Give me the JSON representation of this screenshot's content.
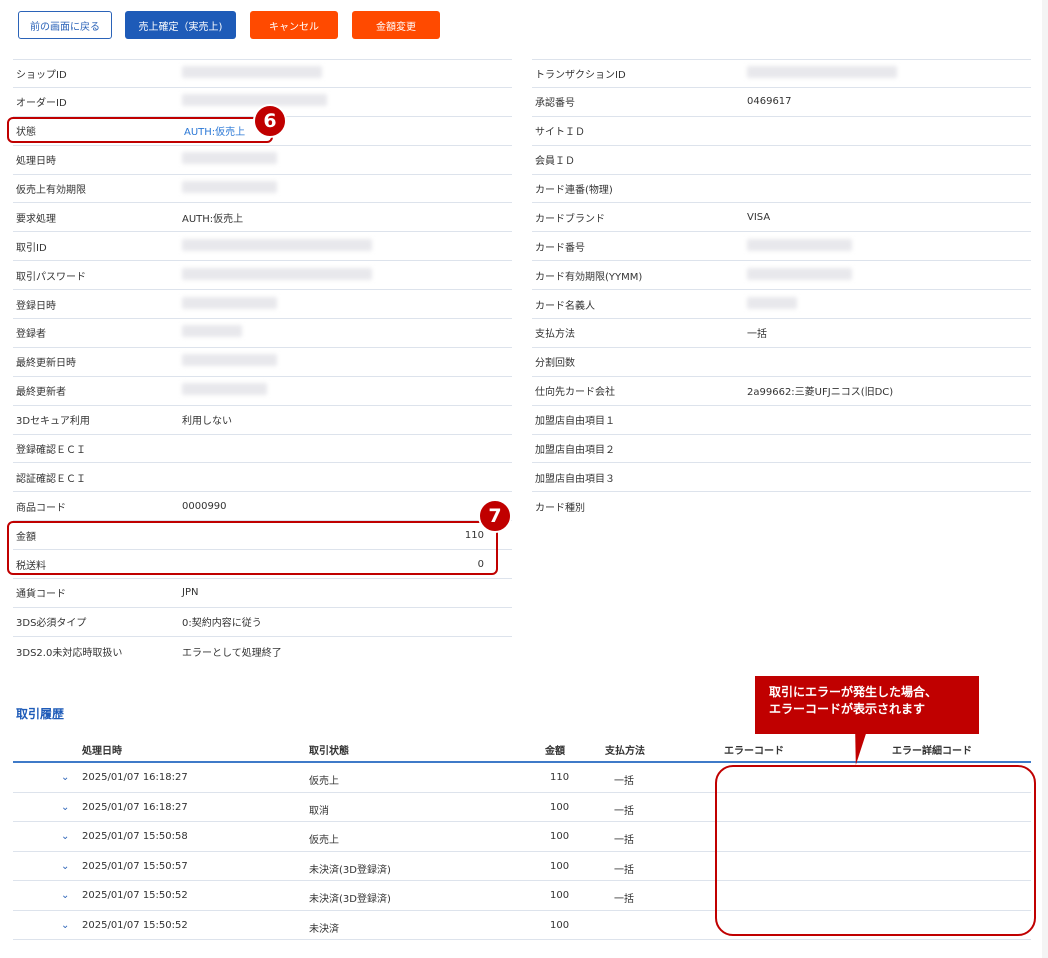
{
  "buttons": {
    "back": "前の画面に戻る",
    "confirm": "売上確定（実売上)",
    "cancel": "キャンセル",
    "amount_change": "金額変更"
  },
  "detail_left": [
    {
      "label": "ショップID",
      "value": ""
    },
    {
      "label": "オーダーID",
      "value": ""
    },
    {
      "label": "状態",
      "value": "AUTH:仮売上"
    },
    {
      "label": "処理日時",
      "value": ""
    },
    {
      "label": "仮売上有効期限",
      "value": ""
    },
    {
      "label": "要求処理",
      "value": "AUTH:仮売上"
    },
    {
      "label": "取引ID",
      "value": ""
    },
    {
      "label": "取引パスワード",
      "value": ""
    },
    {
      "label": "登録日時",
      "value": ""
    },
    {
      "label": "登録者",
      "value": ""
    },
    {
      "label": "最終更新日時",
      "value": ""
    },
    {
      "label": "最終更新者",
      "value": ""
    },
    {
      "label": "3Dセキュア利用",
      "value": "利用しない"
    },
    {
      "label": "登録確認ＥＣＩ",
      "value": ""
    },
    {
      "label": "認証確認ＥＣＩ",
      "value": ""
    },
    {
      "label": "商品コード",
      "value": "0000990"
    },
    {
      "label": "金額",
      "value": "110"
    },
    {
      "label": "税送料",
      "value": "0"
    },
    {
      "label": "通貨コード",
      "value": "JPN"
    },
    {
      "label": "3DS必須タイプ",
      "value": "0:契約内容に従う"
    },
    {
      "label": "3DS2.0未対応時取扱い",
      "value": "エラーとして処理終了"
    }
  ],
  "detail_right": [
    {
      "label": "トランザクションID",
      "value": ""
    },
    {
      "label": "承認番号",
      "value": "0469617"
    },
    {
      "label": "サイトＩＤ",
      "value": ""
    },
    {
      "label": "会員ＩＤ",
      "value": ""
    },
    {
      "label": "カード連番(物理)",
      "value": ""
    },
    {
      "label": "カードブランド",
      "value": "VISA"
    },
    {
      "label": "カード番号",
      "value": ""
    },
    {
      "label": "カード有効期限(YYMM)",
      "value": ""
    },
    {
      "label": "カード名義人",
      "value": ""
    },
    {
      "label": "支払方法",
      "value": "一括"
    },
    {
      "label": "分割回数",
      "value": ""
    },
    {
      "label": "仕向先カード会社",
      "value": "2a99662:三菱UFJニコス(旧DC)"
    },
    {
      "label": "加盟店自由項目１",
      "value": ""
    },
    {
      "label": "加盟店自由項目２",
      "value": ""
    },
    {
      "label": "加盟店自由項目３",
      "value": ""
    },
    {
      "label": "カード種別",
      "value": ""
    }
  ],
  "badges": {
    "status": "6",
    "amount": "7"
  },
  "history": {
    "title": "取引履歴",
    "columns": [
      "処理日時",
      "取引状態",
      "金額",
      "支払方法",
      "エラーコード",
      "エラー詳細コード"
    ],
    "rows": [
      {
        "date": "2025/01/07 16:18:27",
        "status": "仮売上",
        "amount": "110",
        "method": "一括"
      },
      {
        "date": "2025/01/07 16:18:27",
        "status": "取消",
        "amount": "100",
        "method": "一括"
      },
      {
        "date": "2025/01/07 15:50:58",
        "status": "仮売上",
        "amount": "100",
        "method": "一括"
      },
      {
        "date": "2025/01/07 15:50:57",
        "status": "未決済(3D登録済)",
        "amount": "100",
        "method": "一括"
      },
      {
        "date": "2025/01/07 15:50:52",
        "status": "未決済(3D登録済)",
        "amount": "100",
        "method": "一括"
      },
      {
        "date": "2025/01/07 15:50:52",
        "status": "未決済",
        "amount": "100",
        "method": ""
      }
    ]
  },
  "callout": {
    "line1": "取引にエラーが発生した場合、",
    "line2": "エラーコードが表示されます"
  },
  "colors": {
    "primary": "#1e5bb8",
    "danger": "#ff4a00",
    "annotation": "#c00000"
  },
  "icons": {
    "expand": "chevron-down-icon"
  }
}
